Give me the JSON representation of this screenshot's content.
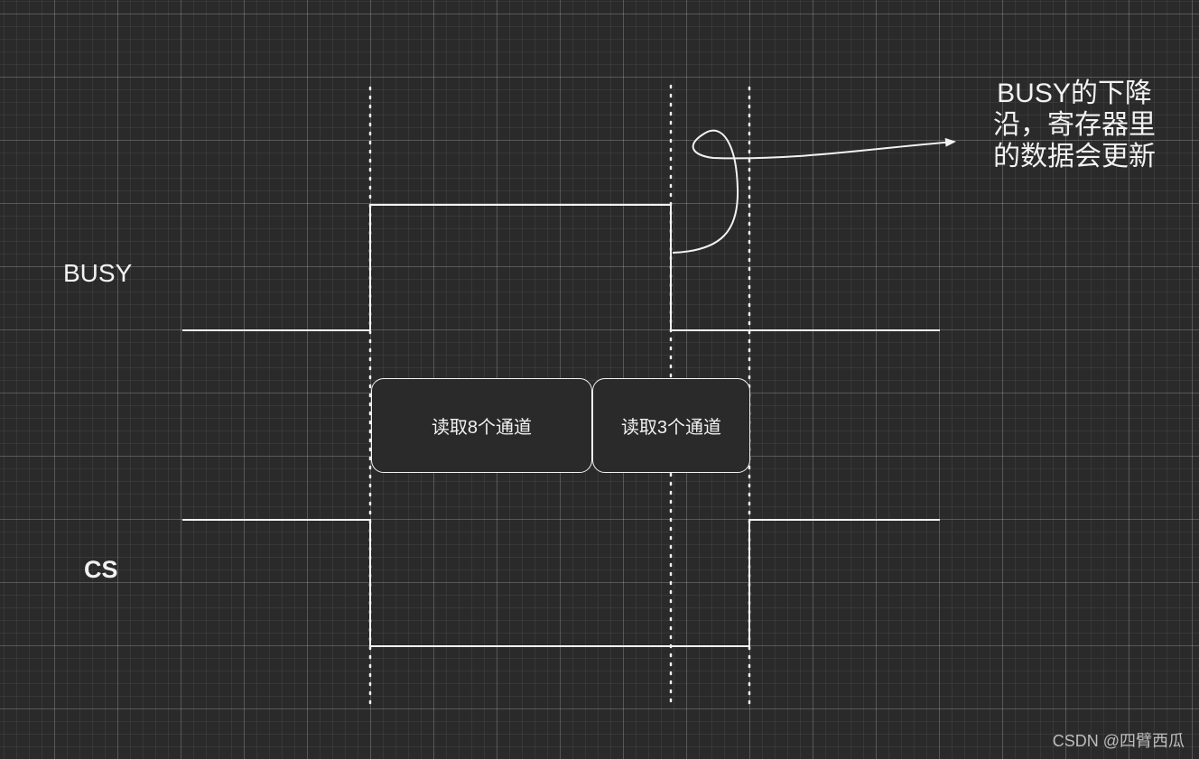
{
  "signals": {
    "busy_label": "BUSY",
    "cs_label": "CS"
  },
  "boxes": {
    "read8": "读取8个通道",
    "read3": "读取3个通道"
  },
  "annotation": {
    "line1": "BUSY的下降",
    "line2": "沿，寄存器里",
    "line3": "的数据会更新"
  },
  "watermark": "CSDN @四臂西瓜",
  "colors": {
    "background": "#2a2a2a",
    "stroke": "#f2f2f2"
  }
}
